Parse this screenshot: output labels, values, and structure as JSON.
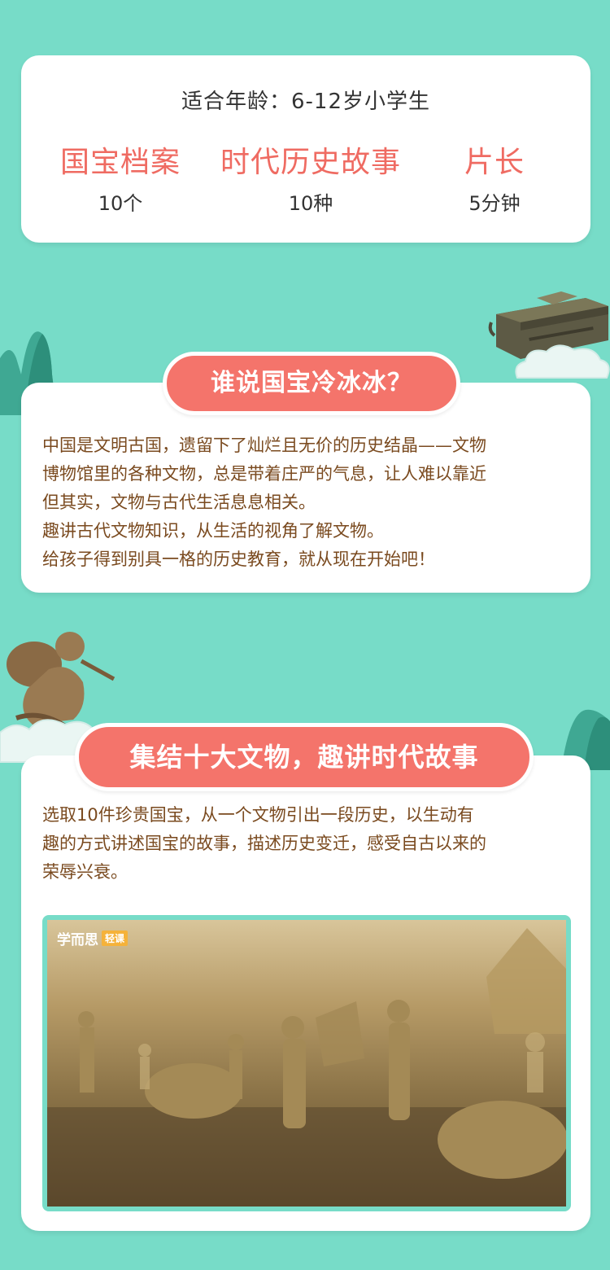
{
  "info": {
    "age_label": "适合年龄：6-12岁小学生",
    "stats": [
      {
        "title": "国宝档案",
        "value": "10个"
      },
      {
        "title": "时代历史故事",
        "value": "10种"
      },
      {
        "title": "片长",
        "value": "5分钟"
      }
    ]
  },
  "section1": {
    "heading": "谁说国宝冷冰冰？",
    "lines": [
      "中国是文明古国，遗留下了灿烂且无价的历史结晶——文物",
      "博物馆里的各种文物，总是带着庄严的气息，让人难以靠近",
      "但其实，文物与古代生活息息相关。",
      "趣讲古代文物知识，从生活的视角了解文物。",
      "给孩子得到别具一格的历史教育，就从现在开始吧！"
    ]
  },
  "section2": {
    "heading": "集结十大文物，趣讲时代故事",
    "lines": [
      "选取10件珍贵国宝，从一个文物引出一段历史，以生动有",
      "趣的方式讲述国宝的故事，描述历史变迁，感受自古以来的",
      "荣辱兴衰。"
    ],
    "video": {
      "brand": "学而思",
      "brand_tag": "轻课"
    }
  },
  "colors": {
    "background": "#77dcc8",
    "accent": "#f4746b",
    "title_red": "#ef6b62",
    "body_brown": "#7a4a1f"
  }
}
